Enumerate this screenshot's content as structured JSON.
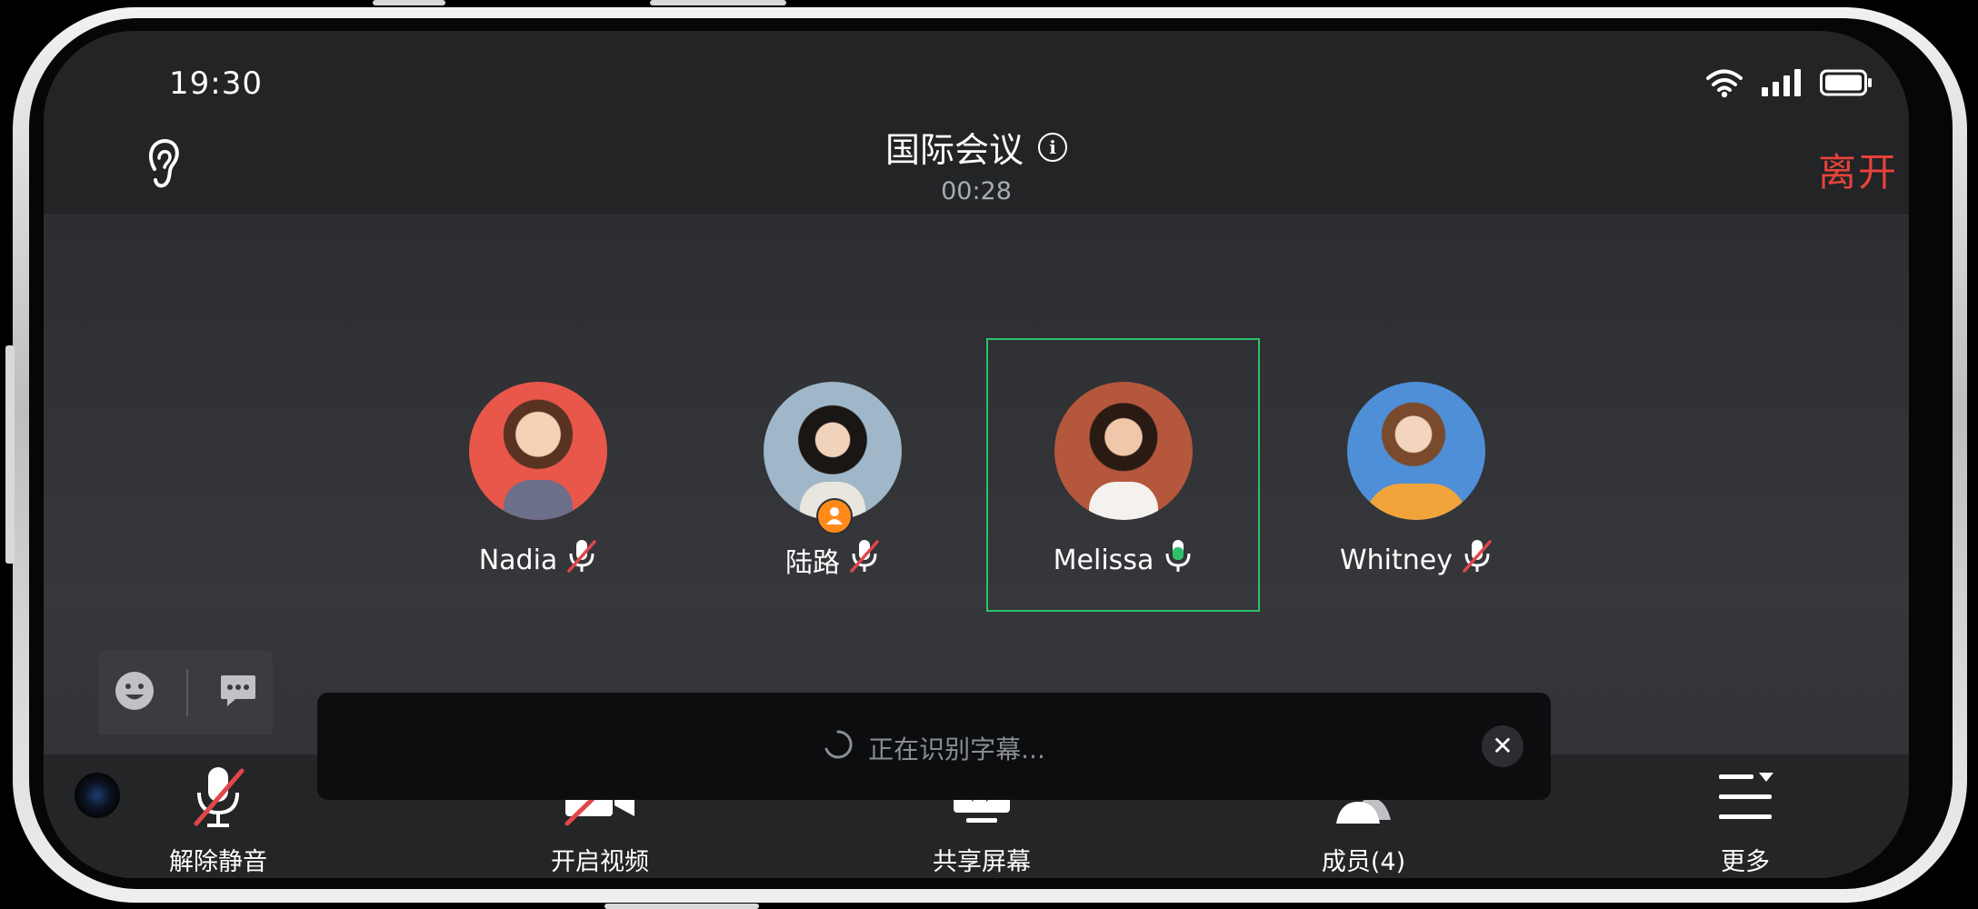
{
  "status": {
    "time": "19:30"
  },
  "meeting": {
    "title": "国际会议",
    "timer": "00:28",
    "leave_label": "离开"
  },
  "participants": [
    {
      "name": "Nadia",
      "mic": "muted",
      "host": false,
      "speaking": false,
      "avatar_color": "#e8574a"
    },
    {
      "name": "陆路",
      "mic": "muted",
      "host": true,
      "speaking": false,
      "avatar_color": "#9fb7c8"
    },
    {
      "name": "Melissa",
      "mic": "active",
      "host": false,
      "speaking": true,
      "avatar_color": "#b5573c"
    },
    {
      "name": "Whitney",
      "mic": "muted",
      "host": false,
      "speaking": false,
      "avatar_color": "#4f8fd8"
    }
  ],
  "captions": {
    "status_text": "正在识别字幕..."
  },
  "toolbar": {
    "unmute_label": "解除静音",
    "video_label": "开启视频",
    "share_label": "共享屏幕",
    "members_label": "成员(4)",
    "more_label": "更多"
  },
  "colors": {
    "accent_green": "#2fbf6b",
    "leave_red": "#e8423b",
    "muted_red": "#e0474a",
    "host_orange": "#ff8a1a"
  }
}
